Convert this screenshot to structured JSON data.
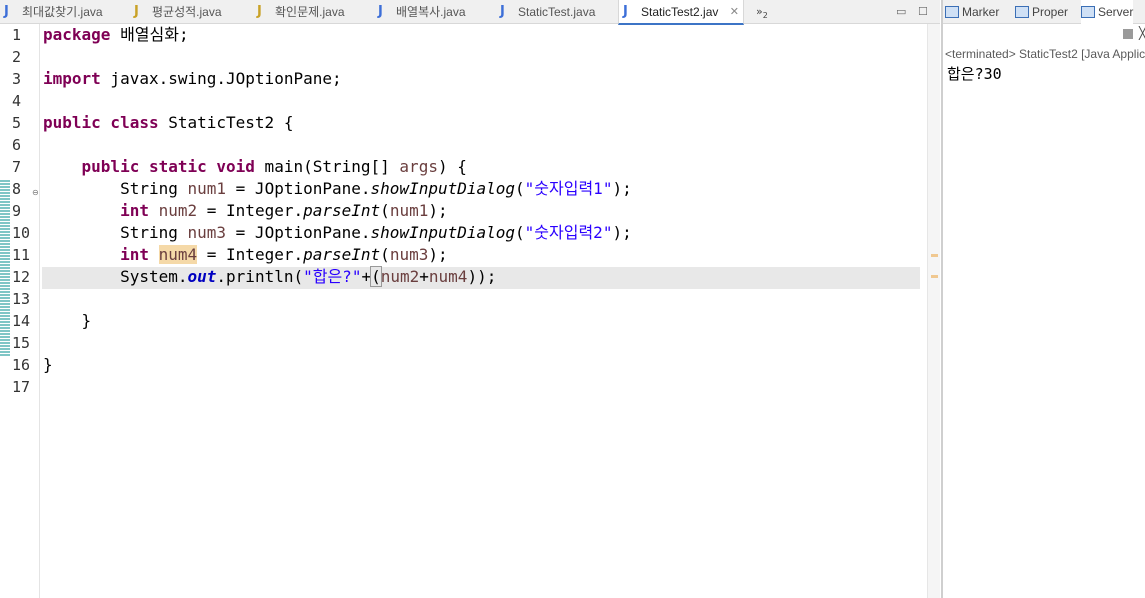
{
  "editor": {
    "tabs": [
      {
        "label": "최대값찾기.java",
        "icon": "java-file-icon",
        "active": false
      },
      {
        "label": "평균성적.java",
        "icon": "java-file-dirty-icon",
        "active": false
      },
      {
        "label": "확인문제.java",
        "icon": "java-file-dirty-icon",
        "active": false
      },
      {
        "label": "배열복사.java",
        "icon": "java-file-icon",
        "active": false
      },
      {
        "label": "StaticTest.java",
        "icon": "java-file-icon",
        "active": false
      },
      {
        "label": "StaticTest2.jav",
        "icon": "java-file-icon",
        "active": true
      }
    ],
    "overflow_label": "»",
    "overflow_count": "2",
    "line_numbers": [
      "1",
      "2",
      "3",
      "4",
      "5",
      "6",
      "7",
      "8",
      "9",
      "10",
      "11",
      "12",
      "13",
      "14",
      "15",
      "16",
      "17"
    ],
    "current_line": 12,
    "code": {
      "l1_kw": "package",
      "l1_rest": " 배열심화;",
      "l3_kw": "import",
      "l3_rest": " javax.swing.JOptionPane;",
      "l5_kw": "public class",
      "l5_rest": " StaticTest2 {",
      "l7_indent": "    ",
      "l7_kw": "public static void",
      "l7_mid": " main(String[] ",
      "l7_var": "args",
      "l7_end": ") {",
      "l8_a": "        String ",
      "l8_var": "num1",
      "l8_b": " = JOptionPane.",
      "l8_method": "showInputDialog",
      "l8_c": "(",
      "l8_str": "\"숫자입력1\"",
      "l8_d": ");",
      "l9_indent": "        ",
      "l9_kw": "int",
      "l9_b": " ",
      "l9_var": "num2",
      "l9_c": " = Integer.",
      "l9_method": "parseInt",
      "l9_d": "(",
      "l9_arg": "num1",
      "l9_e": ");",
      "l10_a": "        String ",
      "l10_var": "num3",
      "l10_b": " = JOptionPane.",
      "l10_method": "showInputDialog",
      "l10_c": "(",
      "l10_str": "\"숫자입력2\"",
      "l10_d": ");",
      "l11_indent": "        ",
      "l11_kw": "int",
      "l11_b": " ",
      "l11_var": "num4",
      "l11_c": " = Integer.",
      "l11_method": "parseInt",
      "l11_d": "(",
      "l11_arg": "num3",
      "l11_e": ");",
      "l12_a": "        System.",
      "l12_field": "out",
      "l12_b": ".println(",
      "l12_str": "\"합은?\"",
      "l12_c": "+",
      "l12_paren": "(",
      "l12_var1": "num2",
      "l12_plus": "+",
      "l12_var2": "num4",
      "l12_d": "));",
      "l14": "    }",
      "l16": "}"
    }
  },
  "console": {
    "tabs": [
      {
        "label": "Marker",
        "icon": "markers-icon"
      },
      {
        "label": "Proper",
        "icon": "properties-icon"
      },
      {
        "label": "Server",
        "icon": "servers-icon"
      }
    ],
    "status": "<terminated> StaticTest2 [Java Applic",
    "output": "합은?30"
  },
  "colors": {
    "keyword": "#7f0055",
    "string": "#2a00ff",
    "variable": "#6a3e3e",
    "static_field": "#0000c0",
    "occurrence_highlight": "#f5d9a8",
    "current_line_highlight": "#e8e8e8",
    "change_bar": "#7fc6c6",
    "active_tab_underline": "#3c74c6"
  }
}
